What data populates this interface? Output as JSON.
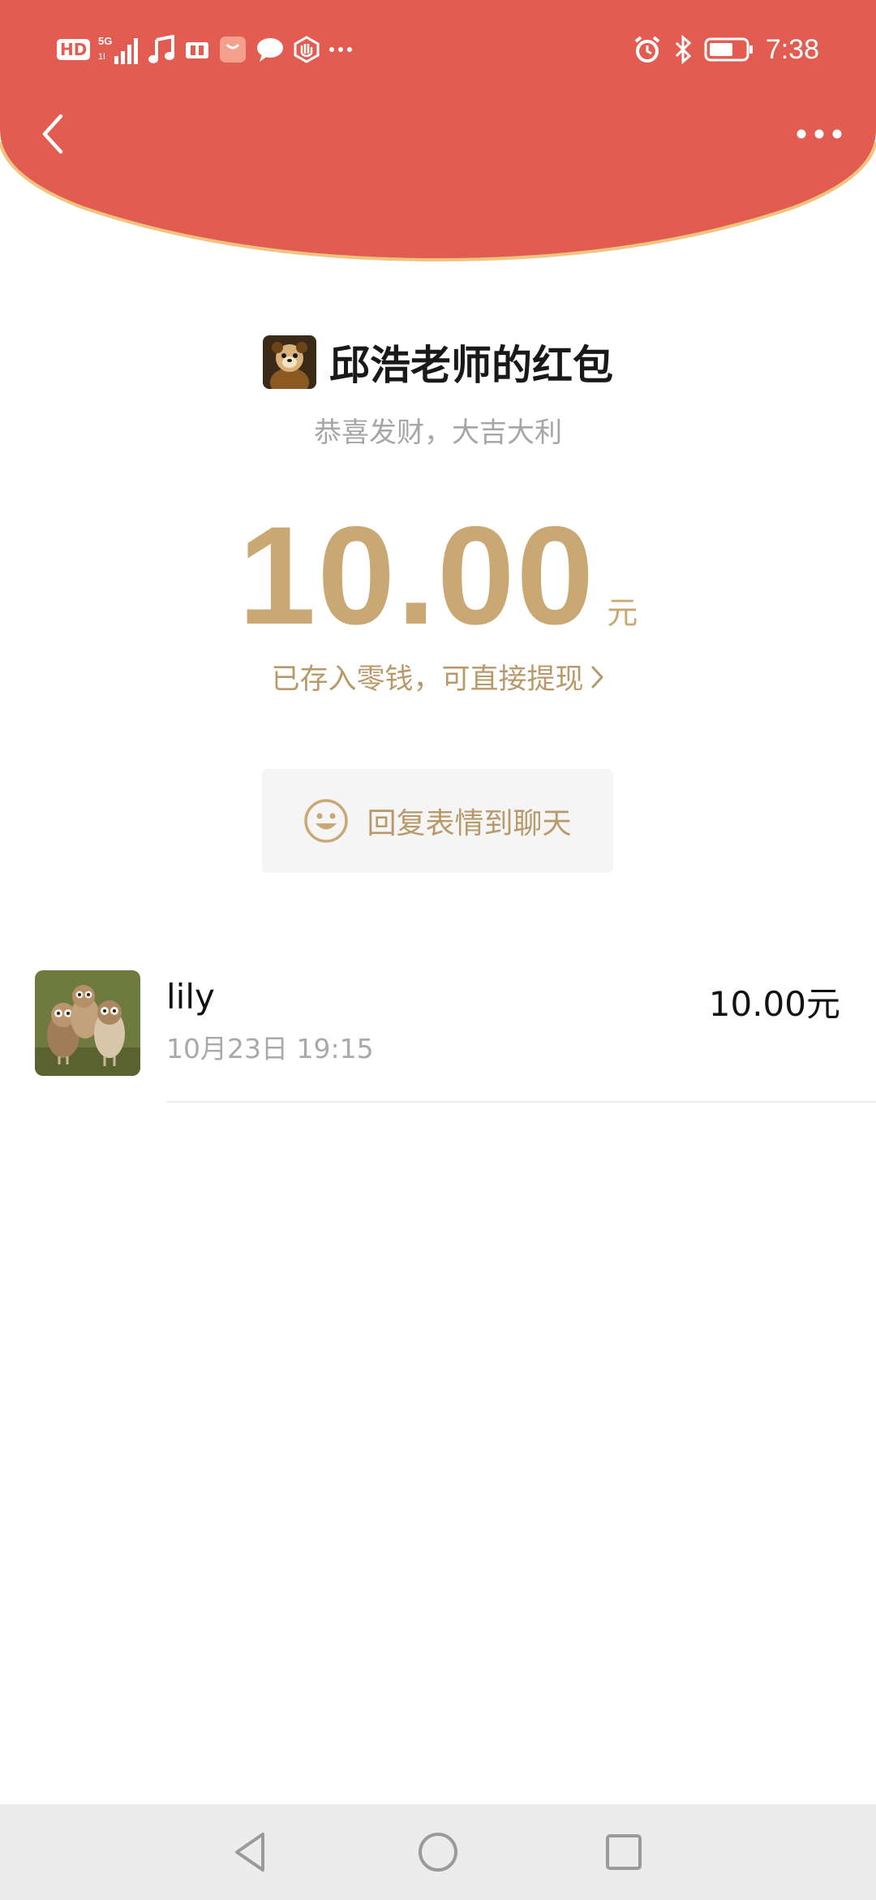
{
  "colors": {
    "header_red": "#e25c51",
    "header_border": "#f0c47e",
    "gold": "#c9a874",
    "gold_text": "#b89a6a",
    "grey_text": "#a6a6a6"
  },
  "status_bar": {
    "left_icons": [
      "hd-icon",
      "5g-signal-icon",
      "music-icon",
      "book-icon",
      "shopping-bag-icon",
      "chat-bubble-icon",
      "hand-icon",
      "more-dots-icon"
    ],
    "hd_label": "HD",
    "right_icons": [
      "alarm-icon",
      "bluetooth-icon",
      "battery-icon"
    ],
    "time": "7:38"
  },
  "header": {
    "back_icon": "chevron-left-icon",
    "more_icon": "more-dots-icon"
  },
  "packet": {
    "sender_title": "邱浩老师的红包",
    "blessing": "恭喜发财，大吉大利",
    "amount": "10.00",
    "unit": "元",
    "saved_note": "已存入零钱，可直接提现"
  },
  "reply": {
    "icon": "smile-icon",
    "label": "回复表情到聊天"
  },
  "receivers": [
    {
      "name": "lily",
      "time": "10月23日  19:15",
      "amount": "10.00元"
    }
  ],
  "system_nav": {
    "icons": [
      "back-triangle-icon",
      "home-circle-icon",
      "recents-square-icon"
    ]
  }
}
